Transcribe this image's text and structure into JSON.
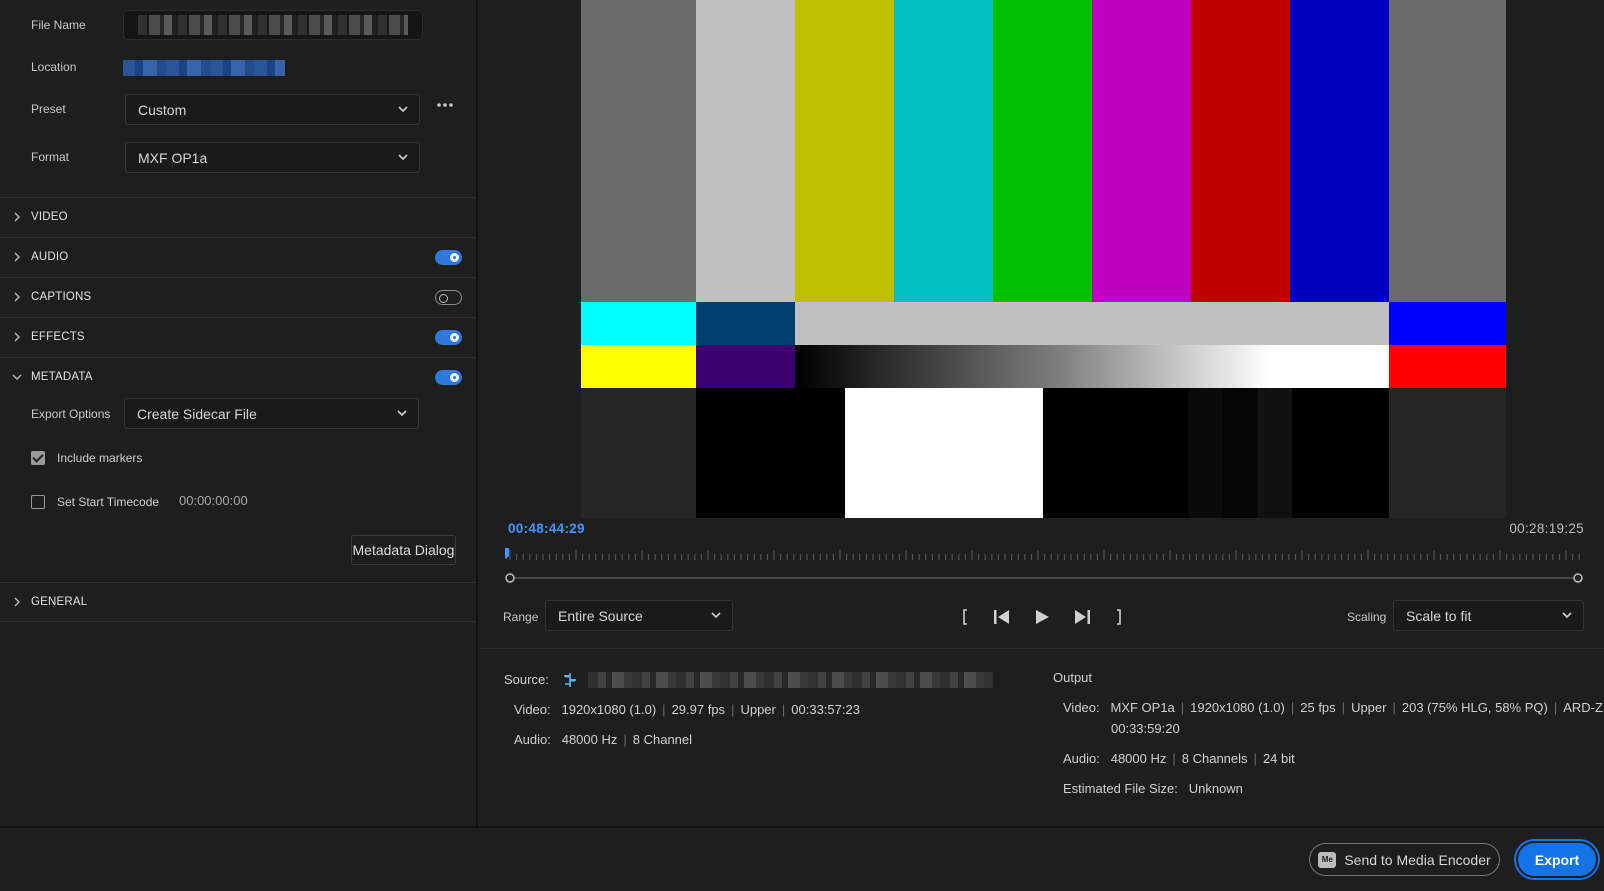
{
  "settings": {
    "file_name_label": "File Name",
    "location_label": "Location",
    "preset_label": "Preset",
    "preset_value": "Custom",
    "format_label": "Format",
    "format_value": "MXF OP1a"
  },
  "sections": {
    "video": "VIDEO",
    "audio": "AUDIO",
    "captions": "CAPTIONS",
    "effects": "EFFECTS",
    "metadata": "METADATA",
    "general": "GENERAL"
  },
  "toggles": {
    "audio": true,
    "captions": false,
    "effects": true,
    "metadata": true
  },
  "metadata": {
    "export_options_label": "Export Options",
    "export_options_value": "Create Sidecar File",
    "include_markers_label": "Include markers",
    "include_markers_checked": true,
    "set_start_timecode_label": "Set Start Timecode",
    "set_start_timecode_checked": false,
    "start_timecode_value": "00:00:00:00",
    "metadata_dialog_button": "Metadata Dialog"
  },
  "preview": {
    "current_timecode": "00:48:44:29",
    "duration_timecode": "00:28:19:25",
    "range_label": "Range",
    "range_value": "Entire Source",
    "scaling_label": "Scaling",
    "scaling_value": "Scale to fit"
  },
  "source": {
    "label": "Source:",
    "video_label": "Video:",
    "video_value": [
      "1920x1080 (1.0)",
      "29.97 fps",
      "Upper",
      "00:33:57:23"
    ],
    "audio_label": "Audio:",
    "audio_value": [
      "48000 Hz",
      "8 Channel"
    ]
  },
  "output": {
    "label": "Output",
    "video_label": "Video:",
    "video_value_line1": [
      "MXF OP1a",
      "1920x1080 (1.0)",
      "25 fps",
      "Upper",
      "203 (75% HLG, 58% PQ)",
      "ARD-ZDF"
    ],
    "video_value_line2": "00:33:59:20",
    "audio_label": "Audio:",
    "audio_value": [
      "48000 Hz",
      "8 Channels",
      "24 bit"
    ],
    "file_size_label": "Estimated File Size:",
    "file_size_value": "Unknown"
  },
  "footer": {
    "send_to_media_encoder": "Send to Media Encoder",
    "me_icon_text": "Me",
    "export": "Export"
  },
  "colors": {
    "accent": "#1473e6",
    "timecode_blue": "#3c97ff",
    "toggle_on": "#2f78dd"
  }
}
